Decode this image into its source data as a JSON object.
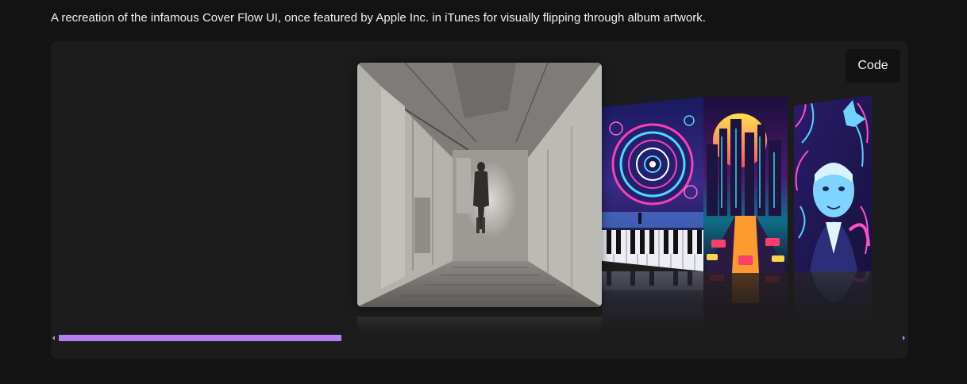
{
  "description": "A recreation of the infamous Cover Flow UI, once featured by Apple Inc. in iTunes for visually flipping through album artwork.",
  "code_button": {
    "label": "Code"
  },
  "covers": [
    {
      "name": "sketch-alley",
      "role": "active"
    },
    {
      "name": "neon-vortex-keyboard",
      "role": "side"
    },
    {
      "name": "synthwave-city-road",
      "role": "side"
    },
    {
      "name": "neon-portrait-creatures",
      "role": "side"
    }
  ],
  "scrollbar": {
    "position": 0.336
  },
  "colors": {
    "background": "#131313",
    "panel": "#1c1c1c",
    "button": "#121212",
    "accent": "#b57ff0"
  }
}
